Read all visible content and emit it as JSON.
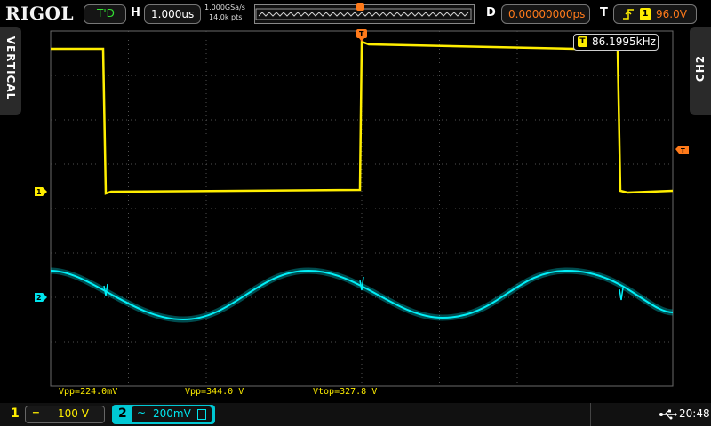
{
  "header": {
    "brand": "RIGOL",
    "run_state": "T'D",
    "horizontal_key": "H",
    "timebase": "1.000us",
    "sample_rate": "1.000GSa/s",
    "memory_depth": "14.0k pts",
    "delay_key": "D",
    "delay": "0.00000000ps",
    "trigger_key": "T",
    "trigger_source": "1",
    "trigger_level": "96.0V"
  },
  "side_tabs": {
    "left": "VERTICAL",
    "right": "CH2"
  },
  "frequency_counter": {
    "badge": "T",
    "value": "86.1995kHz"
  },
  "trigger_marker": "T",
  "channel_markers": {
    "ch1": "1",
    "ch2": "2"
  },
  "measurements": [
    {
      "label": "Vpp=224.0mV"
    },
    {
      "label": "Vpp=344.0 V"
    },
    {
      "label": "Vtop=327.8 V"
    }
  ],
  "footer": {
    "ch1_number": "1",
    "ch1_coupling": "═",
    "ch1_scale": "100 V",
    "ch2_number": "2",
    "ch2_coupling": "~",
    "ch2_scale": "200mV",
    "time": "20:48"
  },
  "colors": {
    "ch1": "#ffee00",
    "ch2": "#00e5ee",
    "accent": "#ff7a1a",
    "grid": "#5a5a5a"
  },
  "icons": {
    "usb": "usb-icon"
  }
}
